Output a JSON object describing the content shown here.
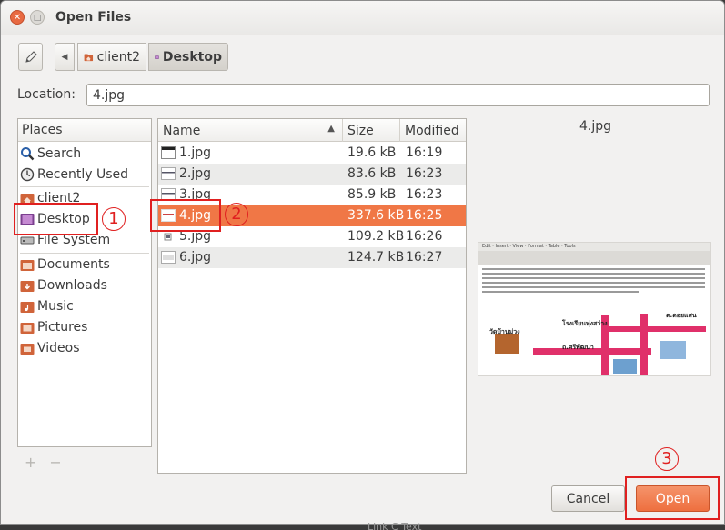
{
  "window": {
    "title": "Open Files"
  },
  "pathbar": {
    "crumbs": [
      {
        "label": "client2",
        "icon": "folder-home-icon"
      },
      {
        "label": "Desktop",
        "icon": "desktop-folder-icon",
        "active": true
      }
    ]
  },
  "location": {
    "label": "Location:",
    "value": "4.jpg"
  },
  "places": {
    "header": "Places",
    "items": [
      {
        "label": "Search",
        "icon": "search-icon"
      },
      {
        "label": "Recently Used",
        "icon": "clock-icon"
      },
      {
        "label": "client2",
        "icon": "folder-home-icon"
      },
      {
        "label": "Desktop",
        "icon": "desktop-folder-icon",
        "selected": true
      },
      {
        "label": "File System",
        "icon": "drive-icon"
      },
      {
        "label": "Documents",
        "icon": "folder-icon"
      },
      {
        "label": "Downloads",
        "icon": "folder-icon"
      },
      {
        "label": "Music",
        "icon": "folder-icon"
      },
      {
        "label": "Pictures",
        "icon": "folder-icon"
      },
      {
        "label": "Videos",
        "icon": "folder-icon"
      }
    ],
    "add_label": "+",
    "remove_label": "−"
  },
  "files": {
    "columns": {
      "name": "Name",
      "size": "Size",
      "modified": "Modified"
    },
    "rows": [
      {
        "name": "1.jpg",
        "size": "19.6 kB",
        "modified": "16:19"
      },
      {
        "name": "2.jpg",
        "size": "83.6 kB",
        "modified": "16:23"
      },
      {
        "name": "3.jpg",
        "size": "85.9 kB",
        "modified": "16:23"
      },
      {
        "name": "4.jpg",
        "size": "337.6 kB",
        "modified": "16:25",
        "selected": true
      },
      {
        "name": "5.jpg",
        "size": "109.2 kB",
        "modified": "16:26"
      },
      {
        "name": "6.jpg",
        "size": "124.7 kB",
        "modified": "16:27"
      }
    ]
  },
  "preview": {
    "filename": "4.jpg",
    "menu": "Edit · Insert · View · Format · Table · Tools",
    "map_labels": [
      "วัดบ้านม่วง",
      "โรงเรียนทุ่งสว่าง",
      "ถ.ศรีพัฒนา",
      "ต.ดอยแสน"
    ]
  },
  "buttons": {
    "cancel": "Cancel",
    "open": "Open"
  },
  "annotations": [
    "1",
    "2",
    "3"
  ],
  "background": {
    "bottom_text": "Link C Text"
  },
  "colors": {
    "accent": "#f07746",
    "annotation": "#e02020"
  }
}
